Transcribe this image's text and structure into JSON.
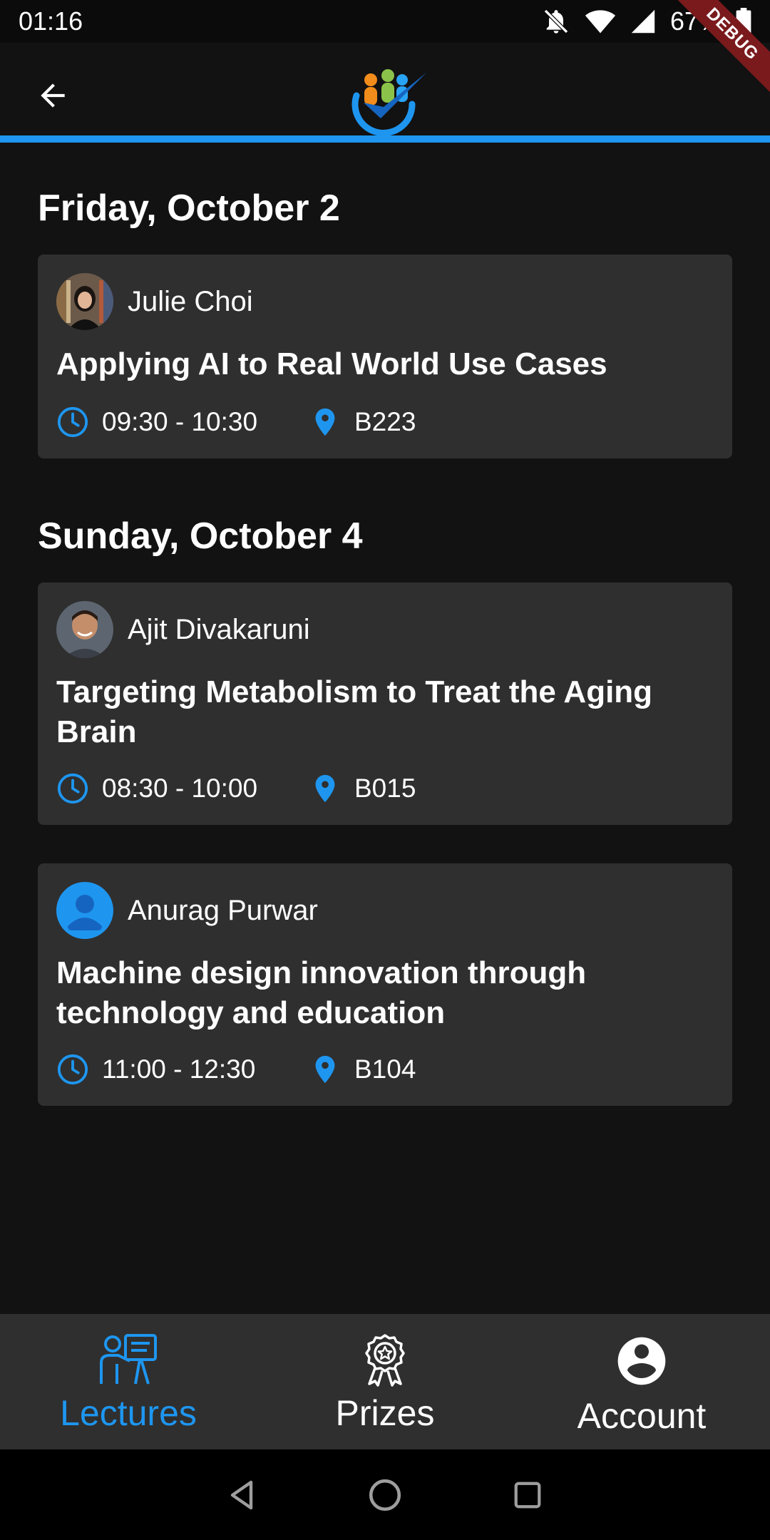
{
  "status_bar": {
    "time": "01:16",
    "battery": "67%"
  },
  "debug_banner": "DEBUG",
  "app_bar": {
    "logo_icon": "people-check-logo-icon",
    "back_icon": "arrow-back-icon"
  },
  "colors": {
    "accent": "#1e96f0",
    "card": "#2f2f2f",
    "background": "#121212",
    "debug": "#7a1a1d"
  },
  "days": [
    {
      "date": "Friday, October 2",
      "lectures": [
        {
          "speaker": "Julie Choi",
          "title": "Applying AI to Real World Use Cases",
          "time": "09:30 - 10:30",
          "room": "B223",
          "avatar": "photo"
        }
      ]
    },
    {
      "date": "Sunday, October 4",
      "lectures": [
        {
          "speaker": "Ajit Divakaruni",
          "title": "Targeting Metabolism to Treat the Aging Brain",
          "time": "08:30 - 10:00",
          "room": "B015",
          "avatar": "photo"
        },
        {
          "speaker": "Anurag Purwar",
          "title": "Machine design innovation through technology and education",
          "time": "11:00 - 12:30",
          "room": "B104",
          "avatar": "placeholder"
        }
      ]
    }
  ],
  "bottom_nav": {
    "items": [
      {
        "label": "Lectures",
        "icon": "lecturer-icon",
        "active": true
      },
      {
        "label": "Prizes",
        "icon": "award-icon",
        "active": false
      },
      {
        "label": "Account",
        "icon": "account-circle-icon",
        "active": false
      }
    ]
  }
}
